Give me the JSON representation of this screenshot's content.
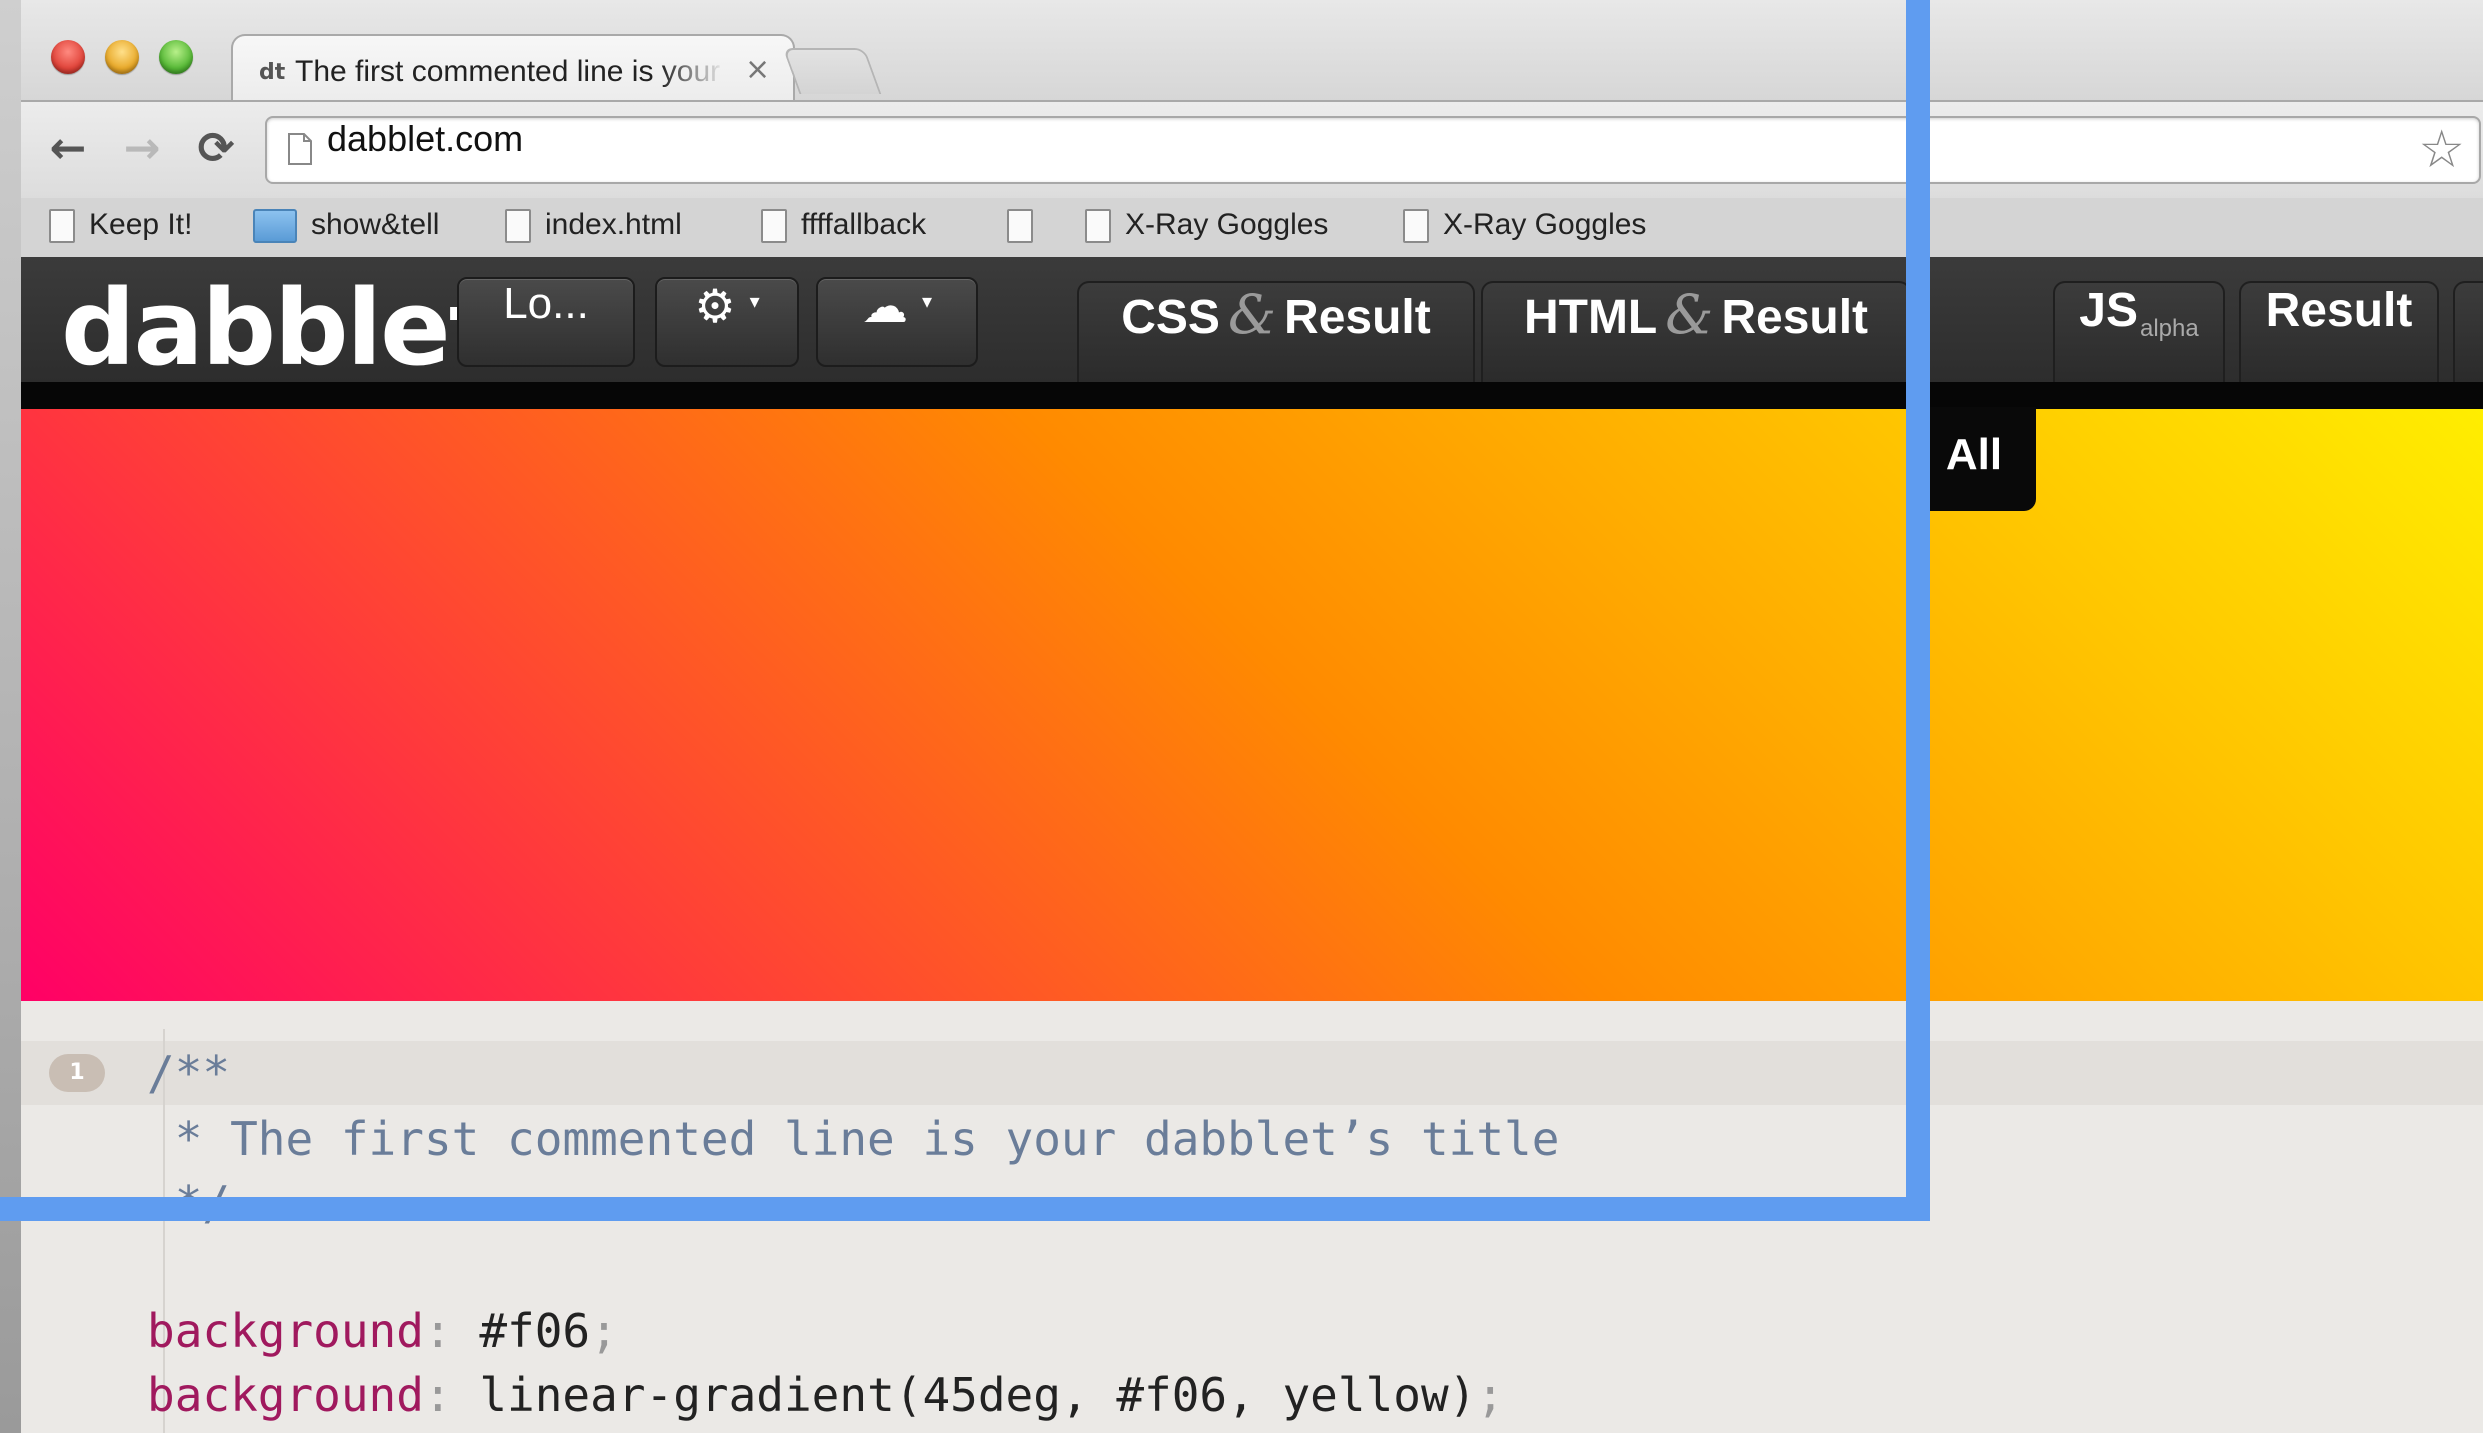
{
  "browser": {
    "tab": {
      "favicon": "dt",
      "title": "The first commented line is your dabblet’s title",
      "close": "×"
    },
    "nav": {
      "back": "←",
      "forward": "→",
      "reload": "⟳"
    },
    "address": "dabblet.com",
    "star": "☆",
    "bookmarks": [
      {
        "label": "Keep It!",
        "icon": "page-icon"
      },
      {
        "label": "show&tell",
        "icon": "folder-icon"
      },
      {
        "label": "index.html",
        "icon": "page-icon"
      },
      {
        "label": "ffffallback",
        "icon": "page-icon"
      },
      {
        "label": "",
        "icon": "page-icon"
      },
      {
        "label": "X-Ray Goggles",
        "icon": "page-icon"
      },
      {
        "label": "X-Ray Goggles",
        "icon": "page-icon"
      }
    ]
  },
  "dabblet": {
    "logo": "dabblet",
    "toolbar": {
      "load_label": "Lo...",
      "settings_icon": "⚙",
      "cloud_icon": "☁",
      "caret": "▾"
    },
    "view_tabs": {
      "css": "CSS",
      "html": "HTML",
      "amp": "&",
      "result": "Result",
      "js": "JS",
      "js_badge": "alpha",
      "all": "All"
    },
    "result_gradient": {
      "angle": "45deg",
      "from": "#ff0066",
      "to": "yellow"
    }
  },
  "editor": {
    "line_number": "1",
    "lines": [
      "/**",
      " * The first commented line is your dabblet’s title",
      " */",
      ""
    ],
    "declarations": [
      {
        "prop": "background",
        "value": "#f06"
      },
      {
        "prop": "background",
        "value": "linear-gradient(45deg, #f06, yellow)"
      }
    ]
  },
  "highlight_color": "#5f9cf0"
}
